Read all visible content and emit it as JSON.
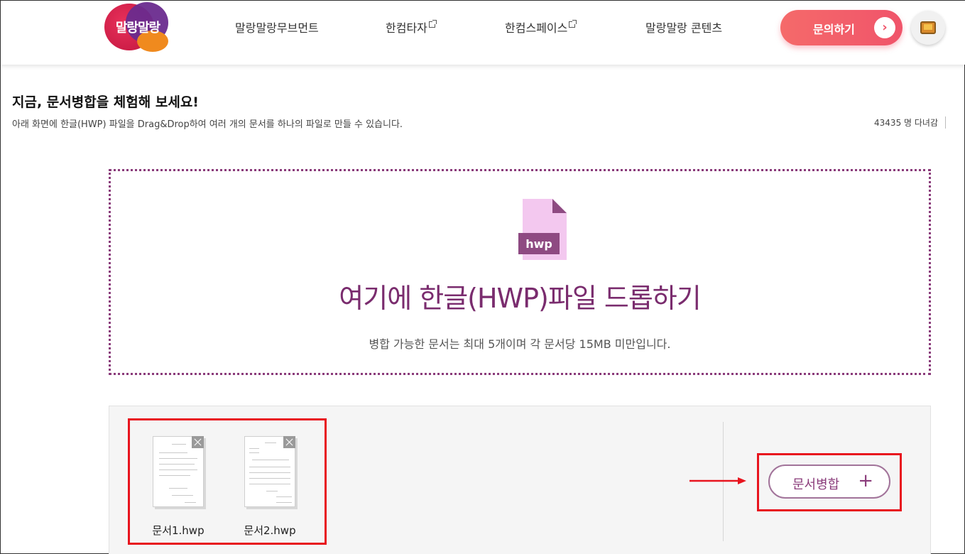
{
  "header": {
    "logo_text": "말랑말랑",
    "nav": [
      {
        "label": "말랑말랑무브먼트",
        "external": false
      },
      {
        "label": "한컴타자",
        "external": true
      },
      {
        "label": "한컴스페이스",
        "external": true
      },
      {
        "label": "말랑말랑 콘텐츠",
        "external": false
      }
    ],
    "contact_label": "문의하기",
    "contact_arrow": "›"
  },
  "intro": {
    "heading": "지금, 문서병합을 체험해 보세요!",
    "description": "아래 화면에 한글(HWP) 파일을 Drag&Drop하여 여러 개의 문서를 하나의 파일로 만들 수 있습니다.",
    "visit_count": "43435 명 다녀감"
  },
  "dropzone": {
    "icon_label": "hwp",
    "title": "여기에 한글(HWP)파일 드롭하기",
    "note": "병합 가능한 문서는 최대 5개이며 각 문서당 15MB  미만입니다."
  },
  "files": [
    {
      "name": "문서1.hwp"
    },
    {
      "name": "문서2.hwp"
    }
  ],
  "merge": {
    "label": "문서병합",
    "plus": "+"
  },
  "colors": {
    "brand_purple": "#7a2c6e",
    "contact_red": "#f0546a",
    "highlight_red": "#e8141e"
  }
}
